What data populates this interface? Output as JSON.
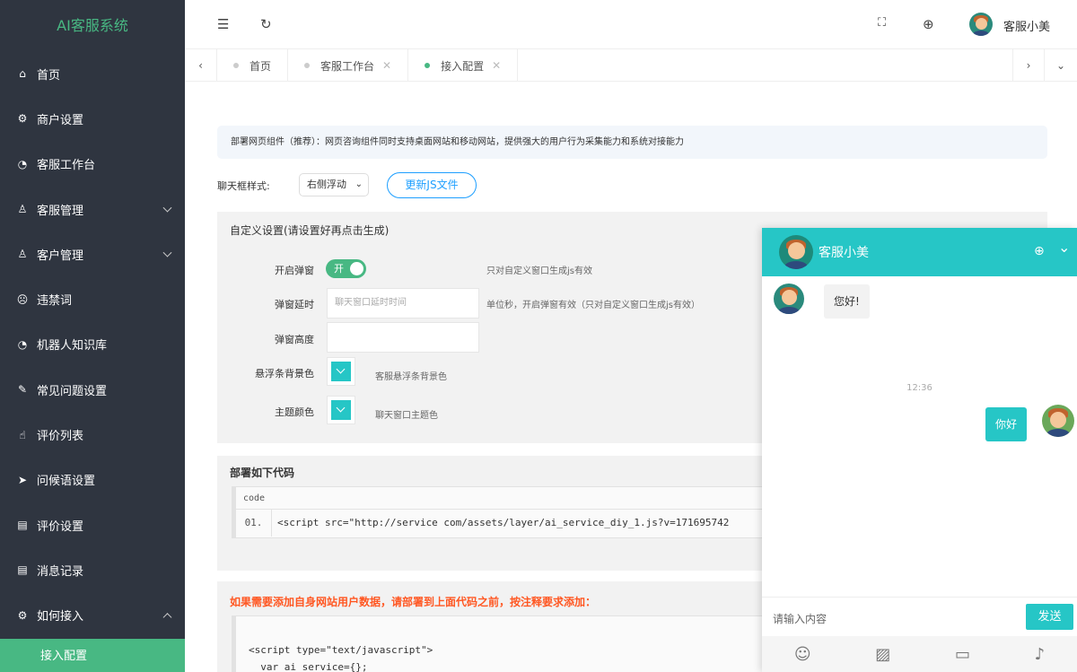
{
  "sidebar": {
    "brand": "AI客服系统",
    "items": [
      {
        "label": "首页",
        "icon": "⌂"
      },
      {
        "label": "商户设置",
        "icon": "⚙"
      },
      {
        "label": "客服工作台",
        "icon": "◔"
      },
      {
        "label": "客服管理",
        "icon": "♙"
      },
      {
        "label": "客户管理",
        "icon": "♙"
      },
      {
        "label": "违禁词",
        "icon": "☹"
      },
      {
        "label": "机器人知识库",
        "icon": "◔"
      },
      {
        "label": "常见问题设置",
        "icon": "✎"
      },
      {
        "label": "评价列表",
        "icon": "☝"
      },
      {
        "label": "问候语设置",
        "icon": "➤"
      },
      {
        "label": "评价设置",
        "icon": "▤"
      },
      {
        "label": "消息记录",
        "icon": "▤"
      },
      {
        "label": "如何接入",
        "icon": "⚙"
      }
    ],
    "active_sub": "接入配置"
  },
  "topbar": {
    "menu_icon": "☰",
    "refresh_icon": "↻",
    "fullscreen_icon": "⛶",
    "globe_icon": "⊕",
    "username": "客服小美"
  },
  "tabs": [
    {
      "label": "首页",
      "closable": false
    },
    {
      "label": "客服工作台",
      "closable": true
    },
    {
      "label": "接入配置",
      "closable": true,
      "active": true
    }
  ],
  "main": {
    "notice": "部署网页组件（推荐）：网页咨询组件同时支持桌面网站和移动网站，提供强大的用户行为采集能力和系统对接能力",
    "chat_style_label": "聊天框样式:",
    "chat_style_value": "右侧浮动",
    "update_js_button": "更新JS文件",
    "custom_title": "自定义设置(请设置好再点击生成)",
    "popup_label": "开启弹窗",
    "popup_switch": "开",
    "popup_hint": "只对自定义窗口生成js有效",
    "delay_label": "弹窗延时",
    "delay_placeholder": "聊天窗口延时时间",
    "delay_hint": "单位秒，开启弹窗有效（只对自定义窗口生成js有效）",
    "height_label": "弹窗高度",
    "float_color_label": "悬浮条背景色",
    "float_color_hint": "客服悬浮条背景色",
    "theme_color_label": "主题颜色",
    "theme_color_hint": "聊天窗口主题色",
    "deploy_title": "部署如下代码",
    "code_header": "code",
    "code_line_no": "01.",
    "code_line": "<script src=\"http://service        com/assets/layer/ai_service_diy_1.js?v=171695742",
    "red_note": "如果需要添加自身网站用户数据，请部署到上面代码之前，按注释要求添加：",
    "code2_line1": "<script type=\"text/javascript\">",
    "code2_line2": "  var ai_service={};"
  },
  "chat": {
    "agent_name": "客服小美",
    "greeting": "您好!",
    "time": "12:36",
    "user_msg": "你好",
    "input_placeholder": "请输入内容",
    "send_button": "发送",
    "tools": [
      "☺",
      "▨",
      "▭",
      "♪"
    ],
    "accent": "#26c6c6"
  }
}
